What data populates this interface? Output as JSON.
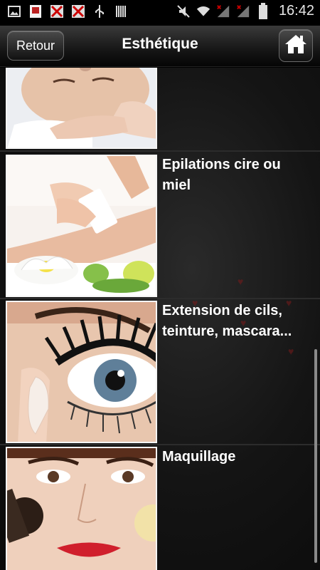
{
  "status_bar": {
    "time": "16:42",
    "icons": [
      "image-icon",
      "app-icon",
      "missed-call-icon",
      "missed-call-icon",
      "usb-icon",
      "barcode-icon",
      "mute-icon",
      "wifi-icon",
      "signal-icon",
      "signal-icon",
      "battery-icon"
    ]
  },
  "header": {
    "back_label": "Retour",
    "title": "Esthétique",
    "home_icon": "home-icon"
  },
  "list": {
    "items": [
      {
        "label": "",
        "image": "face-care-photo"
      },
      {
        "label": "Epilations cire ou miel",
        "image": "waxing-photo"
      },
      {
        "label": "Extension de cils, teinture, mascara...",
        "image": "eyelash-photo"
      },
      {
        "label": "Maquillage",
        "image": "makeup-photo"
      }
    ]
  },
  "colors": {
    "header_top": "#3a3a3a",
    "header_bottom": "#050505",
    "background": "#141414",
    "text": "#ffffff"
  }
}
